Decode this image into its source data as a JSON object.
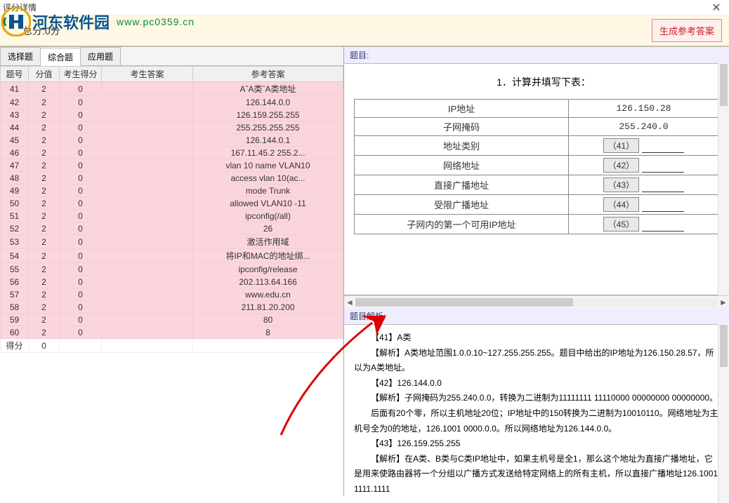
{
  "window": {
    "title": "评分详情",
    "close": "✕"
  },
  "watermark": {
    "name": "河东软件园",
    "url": "www.pc0359.cn"
  },
  "topbar": {
    "score_label": "总分:0分",
    "gen_btn": "生成参考答案"
  },
  "tabs": [
    {
      "label": "选择题",
      "active": false
    },
    {
      "label": "综合题",
      "active": true
    },
    {
      "label": "应用题",
      "active": false
    }
  ],
  "grid": {
    "headers": [
      "题号",
      "分值",
      "考生得分",
      "考生答案",
      "参考答案"
    ],
    "rows": [
      {
        "num": "41",
        "val": "2",
        "score": "0",
        "ans": "",
        "ref": "AˆA类ˆA类地址"
      },
      {
        "num": "42",
        "val": "2",
        "score": "0",
        "ans": "",
        "ref": "126.144.0.0"
      },
      {
        "num": "43",
        "val": "2",
        "score": "0",
        "ans": "",
        "ref": "126.159.255.255"
      },
      {
        "num": "44",
        "val": "2",
        "score": "0",
        "ans": "",
        "ref": "255.255.255.255"
      },
      {
        "num": "45",
        "val": "2",
        "score": "0",
        "ans": "",
        "ref": "126.144.0.1"
      },
      {
        "num": "46",
        "val": "2",
        "score": "0",
        "ans": "",
        "ref": "167.11.45.2 255.2..."
      },
      {
        "num": "47",
        "val": "2",
        "score": "0",
        "ans": "",
        "ref": "vlan 10 name VLAN10"
      },
      {
        "num": "48",
        "val": "2",
        "score": "0",
        "ans": "",
        "ref": "access vlan 10(ac..."
      },
      {
        "num": "49",
        "val": "2",
        "score": "0",
        "ans": "",
        "ref": "mode Trunk"
      },
      {
        "num": "50",
        "val": "2",
        "score": "0",
        "ans": "",
        "ref": "allowed VLAN10 -11"
      },
      {
        "num": "51",
        "val": "2",
        "score": "0",
        "ans": "",
        "ref": "ipconfig(/all)"
      },
      {
        "num": "52",
        "val": "2",
        "score": "0",
        "ans": "",
        "ref": "26"
      },
      {
        "num": "53",
        "val": "2",
        "score": "0",
        "ans": "",
        "ref": "激活作用域"
      },
      {
        "num": "54",
        "val": "2",
        "score": "0",
        "ans": "",
        "ref": "将IP和MAC的地址绑..."
      },
      {
        "num": "55",
        "val": "2",
        "score": "0",
        "ans": "",
        "ref": "ipconfig/release"
      },
      {
        "num": "56",
        "val": "2",
        "score": "0",
        "ans": "",
        "ref": "202.113.64.166"
      },
      {
        "num": "57",
        "val": "2",
        "score": "0",
        "ans": "",
        "ref": "www.edu.cn"
      },
      {
        "num": "58",
        "val": "2",
        "score": "0",
        "ans": "",
        "ref": "211.81.20.200"
      },
      {
        "num": "59",
        "val": "2",
        "score": "0",
        "ans": "",
        "ref": "80"
      },
      {
        "num": "60",
        "val": "2",
        "score": "0",
        "ans": "",
        "ref": "8"
      }
    ],
    "summary": {
      "label": "得分",
      "value": "0"
    }
  },
  "question": {
    "header": "题目:",
    "title": "1．计算并填写下表：",
    "rows": [
      {
        "label": "IP地址",
        "tag": "",
        "val": "126.150.28"
      },
      {
        "label": "子网掩码",
        "tag": "",
        "val": "255.240.0"
      },
      {
        "label": "地址类别",
        "tag": "（41）",
        "val": ""
      },
      {
        "label": "网络地址",
        "tag": "（42）",
        "val": ""
      },
      {
        "label": "直接广播地址",
        "tag": "（43）",
        "val": ""
      },
      {
        "label": "受限广播地址",
        "tag": "（44）",
        "val": ""
      },
      {
        "label": "子网内的第一个可用IP地址",
        "tag": "（45）",
        "val": ""
      }
    ]
  },
  "analysis": {
    "header": "题目解析:",
    "lines": [
      "【41】A类",
      "【解析】A类地址范围1.0.0.10~127.255.255.255。题目中给出的IP地址为126.150.28.57，所以为A类地址。",
      "【42】126.144.0.0",
      "【解析】子网掩码为255.240.0.0，转换为二进制为11111111 11110000 00000000 00000000。",
      "后面有20个零，所以主机地址20位；IP地址中的150转换为二进制为10010110。网络地址为主机号全为0的地址，126.1001 0000.0.0。所以网络地址为126.144.0.0。",
      "【43】126.159.255.255",
      "【解析】在A类、B类与C类IP地址中，如果主机号是全1，那么这个地址为直接广播地址，它是用来使路由器将一个分组以广播方式发送给特定网络上的所有主机，所以直接广播地址126.1001 1111.1111"
    ]
  }
}
